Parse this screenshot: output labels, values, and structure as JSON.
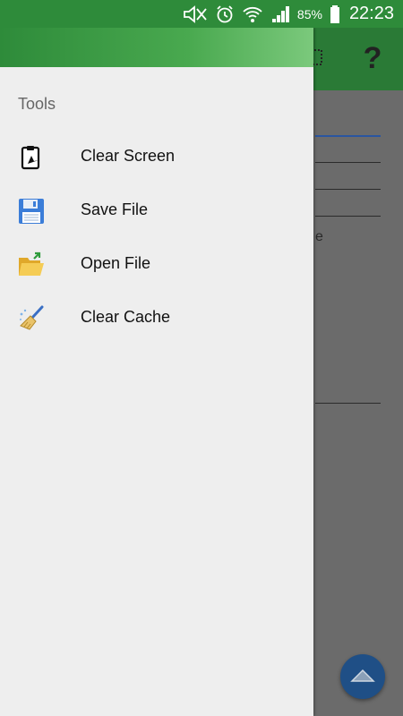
{
  "status_bar": {
    "battery_percent": "85%",
    "time": "22:23",
    "icons": [
      "mute-icon",
      "alarm-icon",
      "wifi-icon",
      "signal-icon",
      "battery-icon"
    ]
  },
  "app": {
    "toolbar_icons": [
      "grid-icon",
      "help-icon"
    ],
    "help_label": "?",
    "partial_text": "e",
    "fab_icon": "chevron-up-icon"
  },
  "drawer": {
    "section_title": "Tools",
    "items": [
      {
        "label": "Clear Screen",
        "icon": "clipboard-clear-icon"
      },
      {
        "label": "Save File",
        "icon": "floppy-disk-icon"
      },
      {
        "label": "Open File",
        "icon": "open-folder-icon"
      },
      {
        "label": "Clear Cache",
        "icon": "broom-icon"
      }
    ]
  }
}
